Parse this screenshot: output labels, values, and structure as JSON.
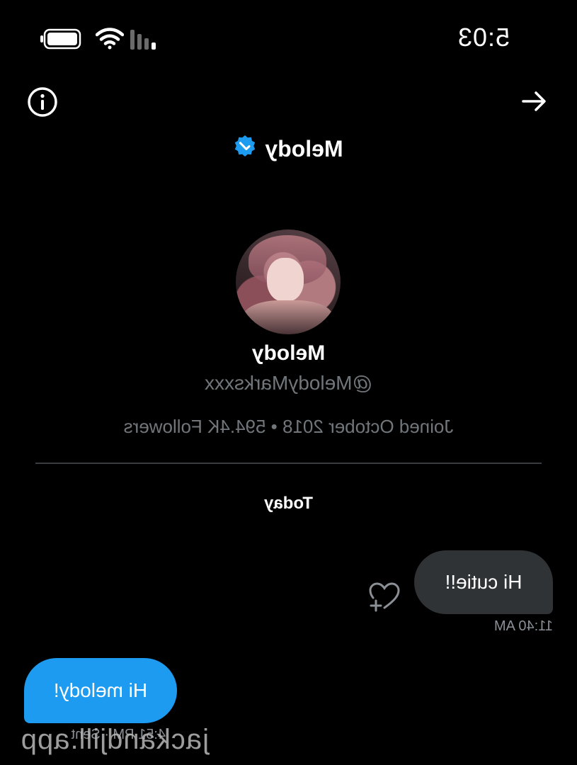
{
  "status_bar": {
    "time": "5:03",
    "icons": [
      "signal-icon",
      "wifi-icon",
      "battery-icon"
    ]
  },
  "header": {
    "title": "Melody",
    "back_icon": "arrow-left-icon",
    "info_icon": "info-icon",
    "verified_icon": "verified-badge-icon"
  },
  "profile": {
    "name": "Melody",
    "handle": "@MelodyMarksxxx",
    "meta": "Joined October 2018 • 594.4K Followers"
  },
  "conversation": {
    "date_separator": "Today",
    "messages": [
      {
        "direction": "incoming",
        "text": "Hi cutie!!",
        "time": "11:40 AM"
      },
      {
        "direction": "outgoing",
        "text": "Hi melody!",
        "status": "4:51 PM · Sent"
      }
    ]
  },
  "watermark": "jackandjill.app",
  "colors": {
    "background": "#000000",
    "accent": "#1d9bf0",
    "incoming_bubble": "#2f3336",
    "secondary_text": "#71767b"
  }
}
